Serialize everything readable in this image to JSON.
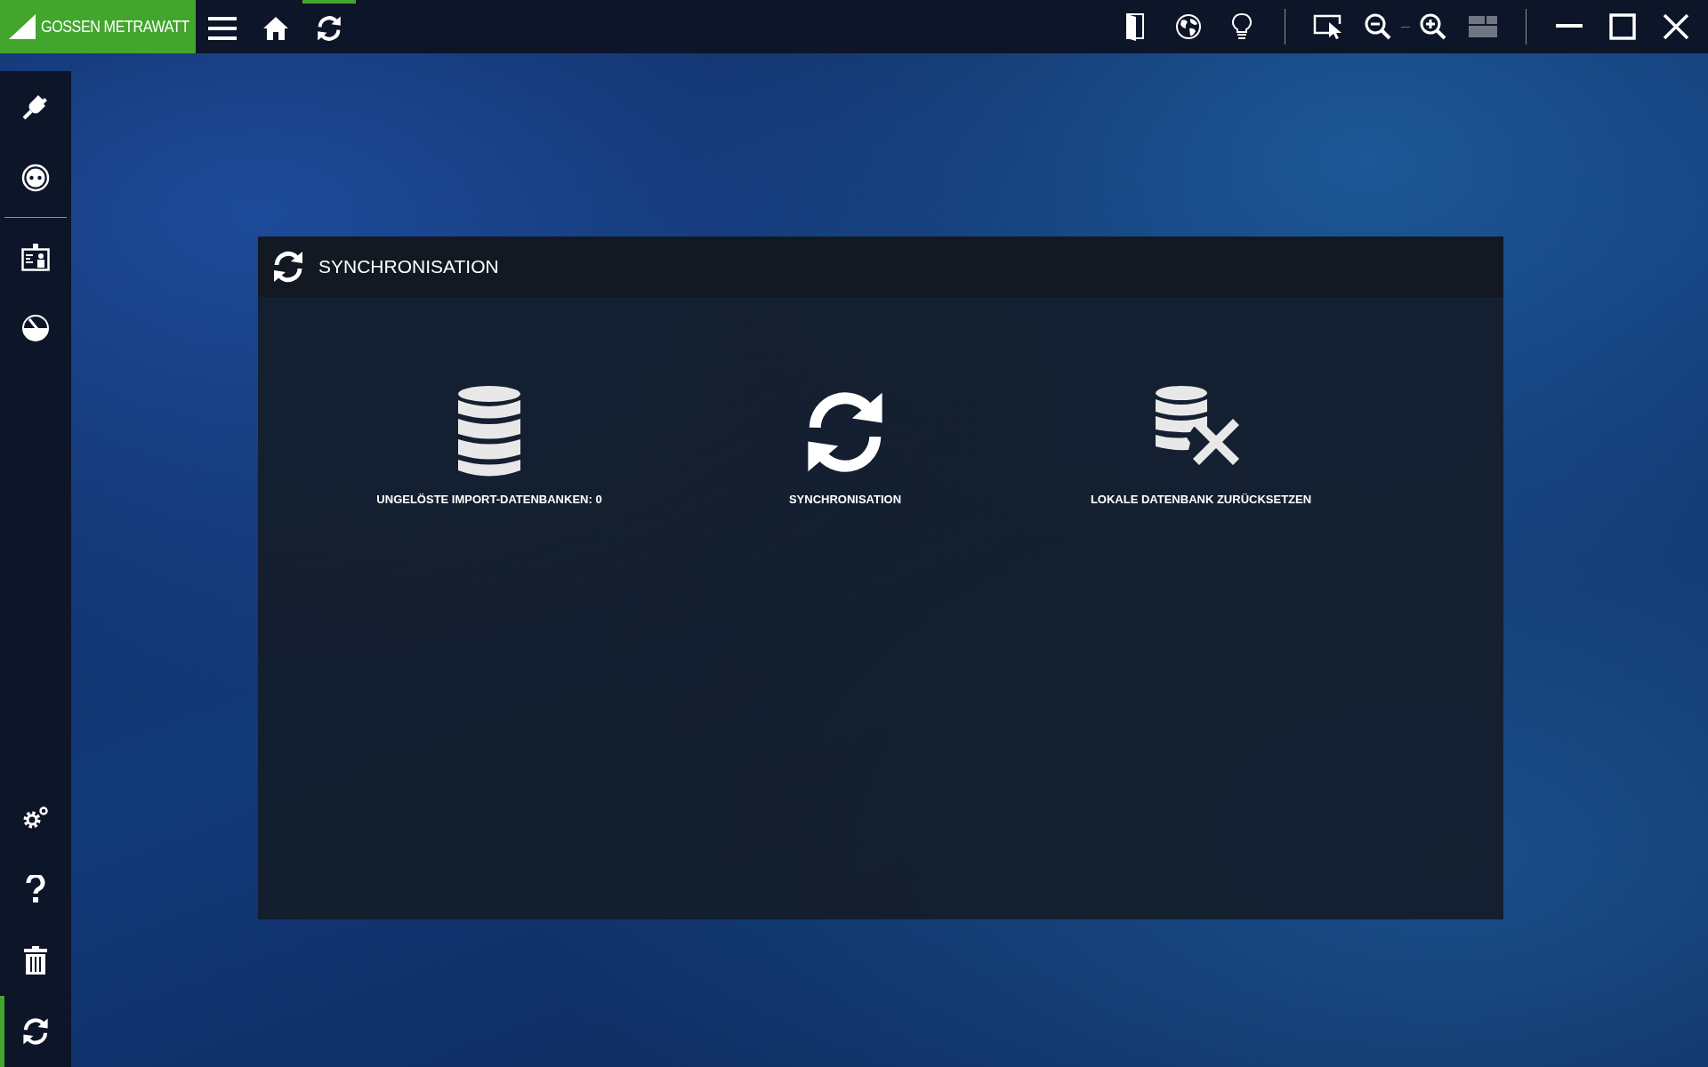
{
  "topbar": {
    "logo": "GOSSEN METRAWATT",
    "nav": [
      {
        "kind": "menu",
        "selected": false
      },
      {
        "kind": "home",
        "selected": false
      },
      {
        "kind": "sync",
        "selected": true
      }
    ],
    "tools": [
      {
        "kind": "door"
      },
      {
        "kind": "globe"
      },
      {
        "kind": "bulb"
      },
      {
        "kind": "sep"
      },
      {
        "kind": "select"
      },
      {
        "kind": "zoomout"
      },
      {
        "kind": "zoomin"
      },
      {
        "kind": "layout"
      },
      {
        "kind": "sep"
      },
      {
        "kind": "minimize"
      },
      {
        "kind": "maximize"
      },
      {
        "kind": "close"
      }
    ]
  },
  "sidebar": {
    "items": [
      {
        "kind": "plug",
        "selected": false
      },
      {
        "kind": "socket",
        "selected": false
      },
      {
        "kind": "divider"
      },
      {
        "kind": "badge",
        "selected": false
      },
      {
        "kind": "gauge",
        "selected": false
      },
      {
        "kind": "spacer"
      },
      {
        "kind": "gears",
        "selected": false
      },
      {
        "kind": "help",
        "selected": false
      },
      {
        "kind": "trash",
        "selected": false
      },
      {
        "kind": "sync",
        "selected": true
      }
    ]
  },
  "panel": {
    "title": "SYNCHRONISATION",
    "actions": [
      {
        "kind": "database",
        "label": "UNGELÖSTE IMPORT-DATENBANKEN: 0"
      },
      {
        "kind": "sync",
        "label": "SYNCHRONISATION"
      },
      {
        "kind": "db-reset",
        "label": "LOKALE DATENBANK ZURÜCKSETZEN"
      }
    ]
  }
}
